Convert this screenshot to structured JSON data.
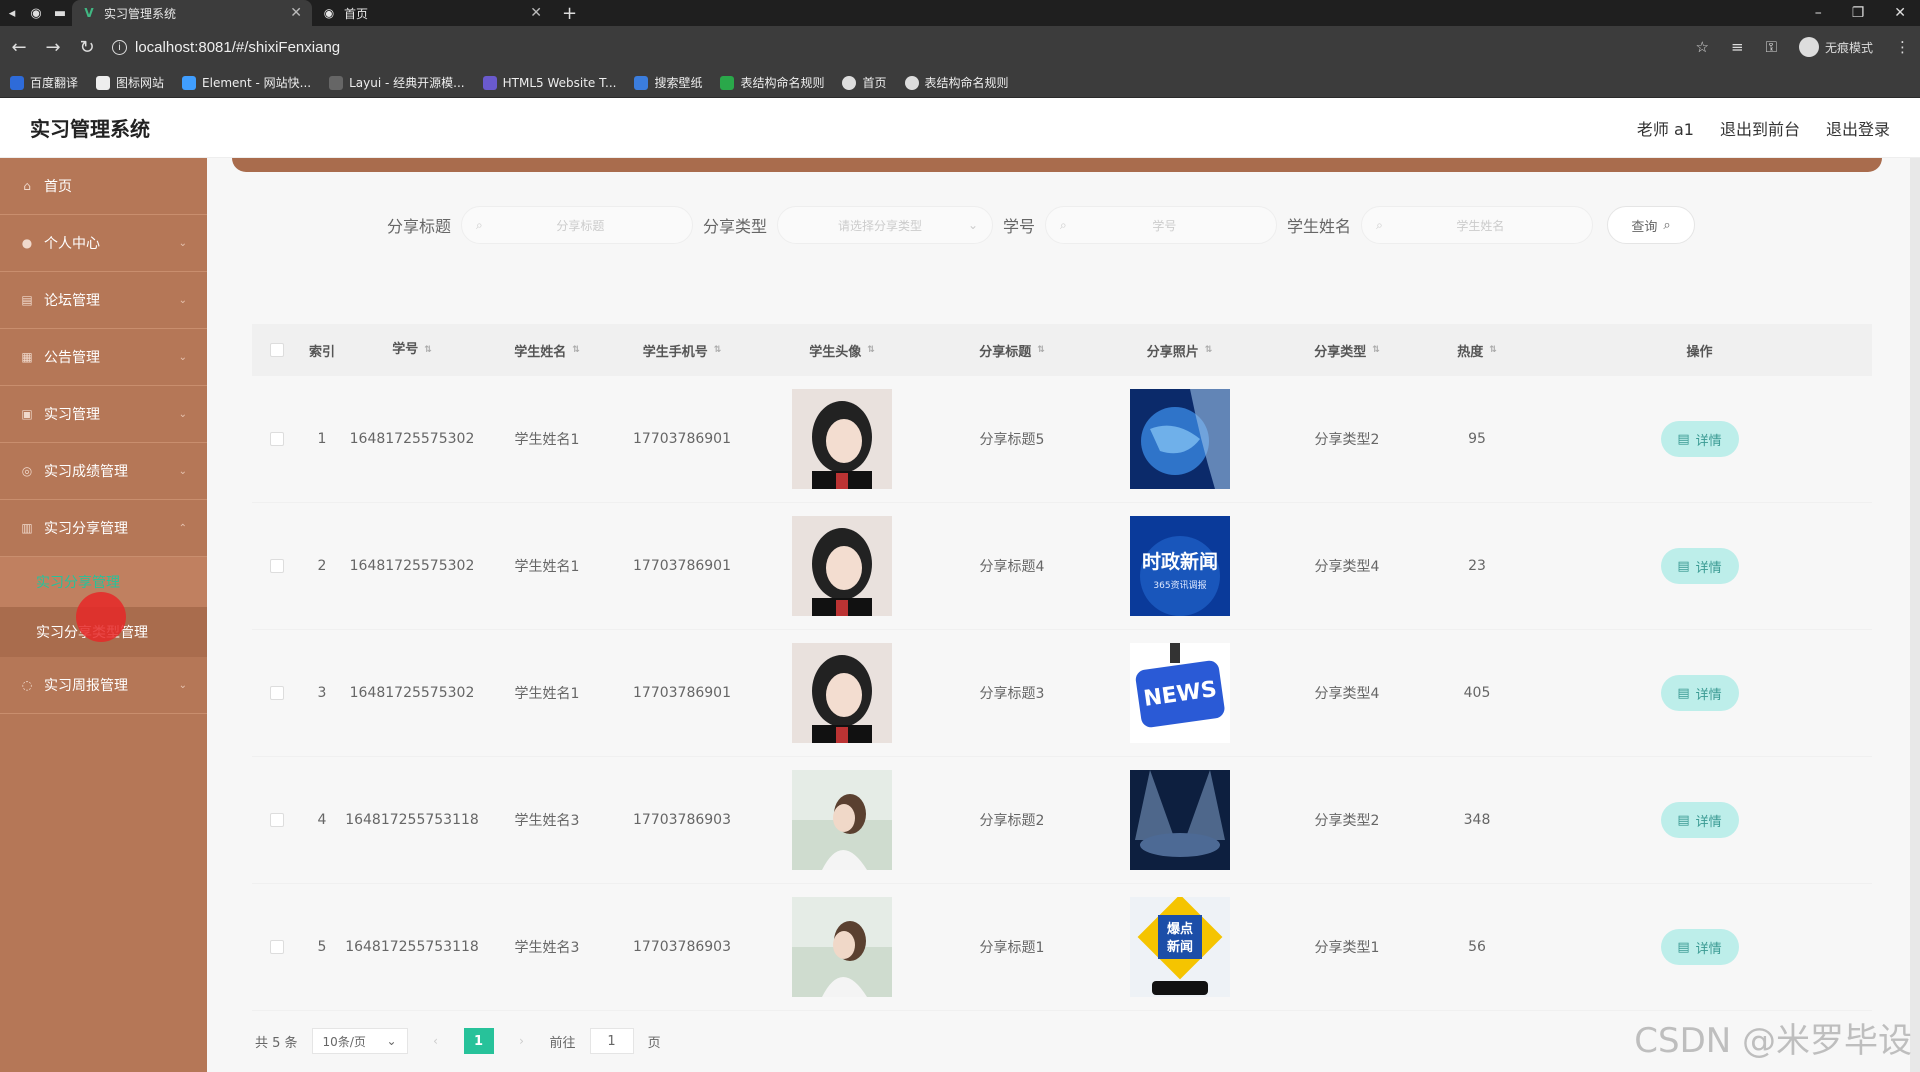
{
  "browser": {
    "tabs": [
      {
        "title": "实习管理系统",
        "active": true
      },
      {
        "title": "首页",
        "active": false
      }
    ],
    "url": "localhost:8081/#/shixiFenxiang",
    "incognito_label": "无痕模式",
    "bookmarks": [
      "百度翻译",
      "图标网站",
      "Element - 网站快...",
      "Layui - 经典开源模...",
      "HTML5 Website T...",
      "搜索壁纸",
      "表结构命名规则",
      "首页",
      "表结构命名规则"
    ]
  },
  "header": {
    "title": "实习管理系统",
    "user": "老师 a1",
    "back_front": "退出到前台",
    "logout": "退出登录"
  },
  "sidebar": {
    "items": [
      {
        "label": "首页",
        "icon": "home-icon"
      },
      {
        "label": "个人中心",
        "icon": "user-icon"
      },
      {
        "label": "论坛管理",
        "icon": "forum-icon"
      },
      {
        "label": "公告管理",
        "icon": "notice-icon"
      },
      {
        "label": "实习管理",
        "icon": "briefcase-icon"
      },
      {
        "label": "实习成绩管理",
        "icon": "score-icon"
      },
      {
        "label": "实习分享管理",
        "icon": "share-icon"
      }
    ],
    "sub_items": [
      {
        "label": "实习分享管理",
        "active": true
      },
      {
        "label": "实习分享类型管理",
        "active": false
      }
    ],
    "last_item": {
      "label": "实习周报管理",
      "icon": "report-icon"
    }
  },
  "search": {
    "title_label": "分享标题",
    "title_placeholder": "分享标题",
    "type_label": "分享类型",
    "type_placeholder": "请选择分享类型",
    "sno_label": "学号",
    "sno_placeholder": "学号",
    "name_label": "学生姓名",
    "name_placeholder": "学生姓名",
    "query_label": "查询"
  },
  "table": {
    "headers": {
      "index": "索引",
      "sno": "学号",
      "name": "学生姓名",
      "phone": "学生手机号",
      "avatar": "学生头像",
      "title": "分享标题",
      "photo": "分享照片",
      "type": "分享类型",
      "heat": "热度",
      "op": "操作"
    },
    "rows": [
      {
        "index": "1",
        "sno_1": "1648172557530",
        "sno_2": "2",
        "name": "学生姓名1",
        "phone": "17703786901",
        "title": "分享标题5",
        "type": "分享类型2",
        "heat": "95",
        "op": "详情"
      },
      {
        "index": "2",
        "sno_1": "1648172557530",
        "sno_2": "2",
        "name": "学生姓名1",
        "phone": "17703786901",
        "title": "分享标题4",
        "type": "分享类型4",
        "heat": "23",
        "op": "详情"
      },
      {
        "index": "3",
        "sno_1": "1648172557530",
        "sno_2": "2",
        "name": "学生姓名1",
        "phone": "17703786901",
        "title": "分享标题3",
        "type": "分享类型4",
        "heat": "405",
        "op": "详情"
      },
      {
        "index": "4",
        "sno_1": "1648172557531",
        "sno_2": "18",
        "name": "学生姓名3",
        "phone": "17703786903",
        "title": "分享标题2",
        "type": "分享类型2",
        "heat": "348",
        "op": "详情"
      },
      {
        "index": "5",
        "sno_1": "1648172557531",
        "sno_2": "18",
        "name": "学生姓名3",
        "phone": "17703786903",
        "title": "分享标题1",
        "type": "分享类型1",
        "heat": "56",
        "op": "详情"
      }
    ],
    "photo_texts": {
      "p2_main": "时政新闻",
      "p2_sub": "365资讯调报",
      "p3": "NEWS",
      "p5_l1": "爆点",
      "p5_l2": "新闻"
    }
  },
  "pagination": {
    "total": "共 5 条",
    "page_size": "10条/页",
    "current": "1",
    "goto_prefix": "前往",
    "goto_value": "1",
    "goto_suffix": "页"
  },
  "watermark": "CSDN @米罗毕设",
  "colors": {
    "sidebar": "#b57757",
    "accent": "#27c29a",
    "detail_btn": "#bdeeea"
  }
}
